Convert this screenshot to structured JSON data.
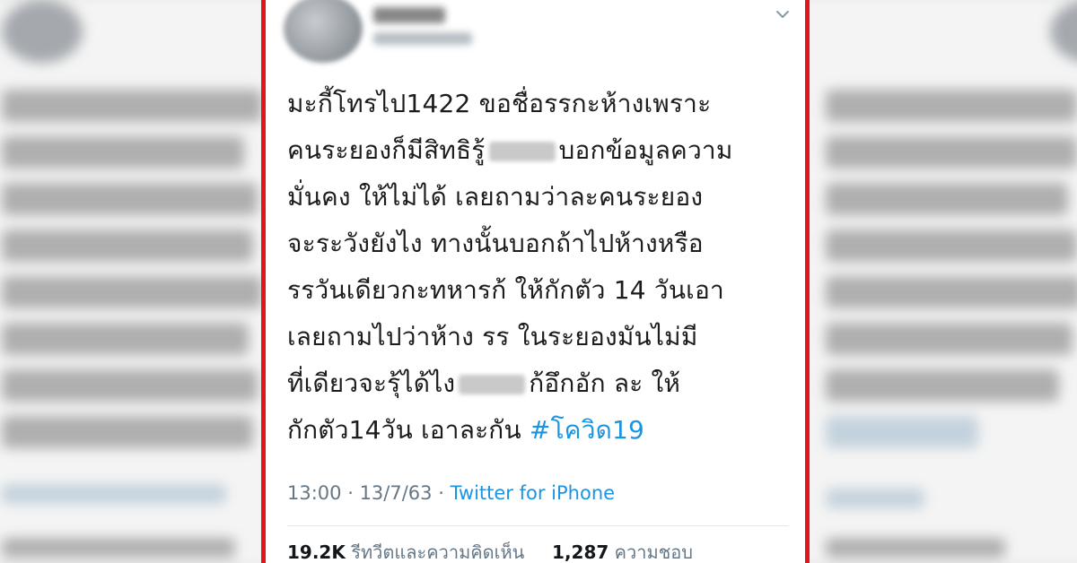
{
  "tweet": {
    "lines": [
      [
        {
          "t": "มะกี้โทรไป1422 ขอชื่อรรกะห้างเพราะ"
        }
      ],
      [
        {
          "t": "คนระยองก็มีสิทธิรู้"
        },
        {
          "redact": true
        },
        {
          "t": "บอกข้อมูลความ"
        }
      ],
      [
        {
          "t": "มั่นคง ให้ไม่ได้ เลยถามว่าละคนระยอง"
        }
      ],
      [
        {
          "t": "จะระวังยังไง ทางนั้นบอกถ้าไปห้างหรือ"
        }
      ],
      [
        {
          "t": "รรวันเดียวกะทหารก้ ให้กักตัว 14 วันเอา"
        }
      ],
      [
        {
          "t": "เลยถามไปว่าห้าง รร ในระยองมันไม่มี"
        }
      ],
      [
        {
          "t": "ที่เดียวจะรุ้ได้ไง"
        },
        {
          "redact": true
        },
        {
          "t": "ก้อึกอัก ละ ให้"
        }
      ],
      [
        {
          "t": "กักตัว14วัน เอาละกัน "
        },
        {
          "hashtag": "#โควิด19"
        }
      ]
    ],
    "time": "13:00",
    "separator": " · ",
    "date": "13/7/63",
    "source": "Twitter for iPhone",
    "retweets_count": "19.2K",
    "retweets_label": "รีทวีตและความคิดเห็น",
    "likes_count": "1,287",
    "likes_label": "ความชอบ"
  },
  "icons": {
    "menu": "chevron-down-icon",
    "avatar": "user-avatar"
  },
  "colors": {
    "frame": "#e3141c",
    "link": "#1b95e0",
    "meta": "#657786",
    "text": "#1c1c1c"
  }
}
